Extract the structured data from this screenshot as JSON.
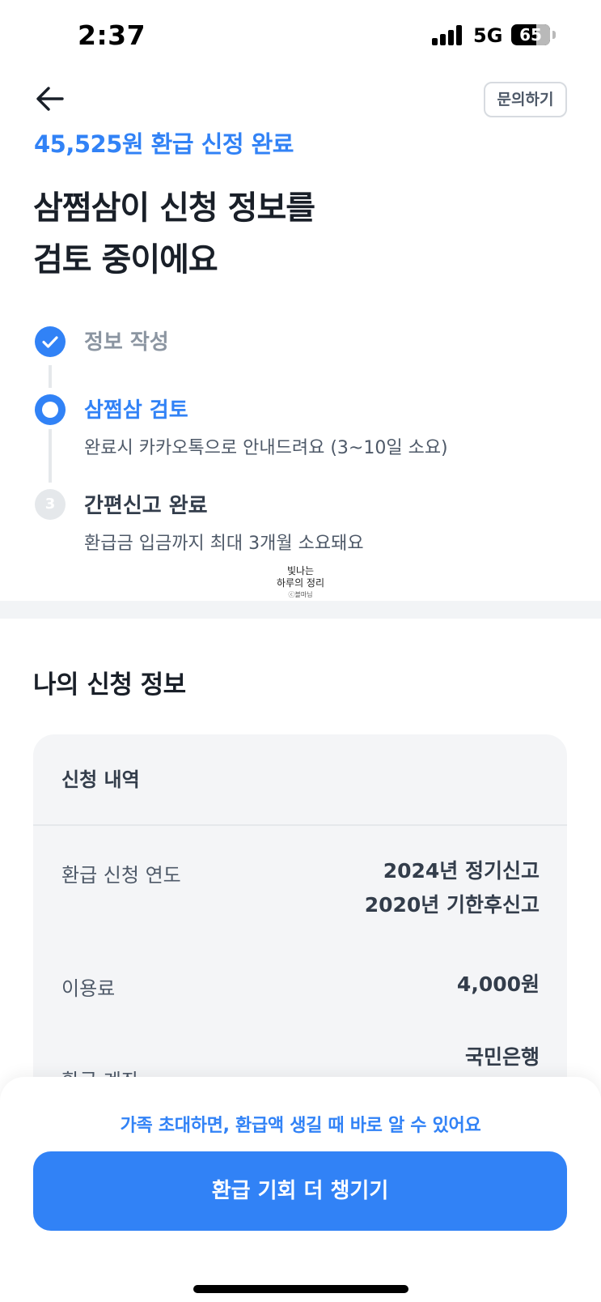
{
  "status_bar": {
    "time": "2:37",
    "network": "5G",
    "battery": "65"
  },
  "header": {
    "back_icon": "arrow-left-icon",
    "inquiry_label": "문의하기"
  },
  "refund": {
    "amount_status": "45,525원 환급 신정 완료",
    "title_line1": "삼쩜삼이 신청 정보를",
    "title_line2": "검토 중이에요"
  },
  "steps": [
    {
      "title": "정보 작성",
      "status": "done"
    },
    {
      "title": "삼쩜삼 검토",
      "desc": "완료시 카카오톡으로 안내드려요 (3~10일 소요)",
      "status": "current"
    },
    {
      "number": "3",
      "title": "간편신고 완료",
      "desc": "환급금 입금까지 최대 3개월 소요돼요",
      "status": "pending"
    }
  ],
  "watermark": {
    "line1": "빛나는",
    "line2": "하루의 정리",
    "line3": "ⓒ블마님"
  },
  "my_application": {
    "section_title": "나의 신청 정보",
    "card_header": "신청 내역",
    "rows": [
      {
        "label": "환급 신청 연도",
        "values": [
          "2024년 정기신고",
          "2020년 기한후신고"
        ]
      },
      {
        "label": "이용료",
        "values": [
          "4,000원"
        ]
      },
      {
        "label": "환급 계좌",
        "values": [
          "국민은행"
        ]
      }
    ]
  },
  "bottom": {
    "invite_text": "가족 초대하면, 환급액 생길 때 바로 알 수 있어요",
    "cta_label": "환급 기회 더 챙기기"
  },
  "colors": {
    "accent": "#3182f6",
    "text_primary": "#191f28",
    "text_secondary": "#4e5968",
    "card_bg": "#f4f5f7",
    "divider": "#e5e8eb"
  }
}
